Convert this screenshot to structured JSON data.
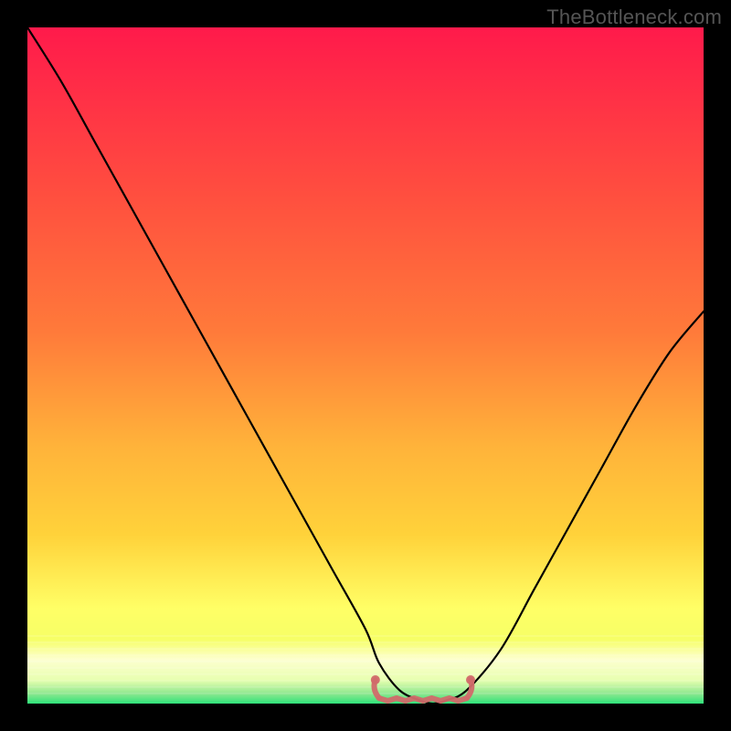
{
  "watermark": "TheBottleneck.com",
  "colors": {
    "background": "#000000",
    "gradient_top": "#ff1a4b",
    "gradient_upper_mid": "#ff7a3a",
    "gradient_mid": "#ffd23a",
    "gradient_lower_mid": "#f6ff66",
    "gradient_band_pale": "#fdffd0",
    "gradient_bottom": "#2fe27a",
    "curve_stroke": "#000000",
    "valley_marker": "#d16a6a"
  },
  "chart_data": {
    "type": "line",
    "title": "",
    "xlabel": "",
    "ylabel": "",
    "xlim": [
      0,
      100
    ],
    "ylim": [
      0,
      100
    ],
    "x": [
      0,
      5,
      10,
      15,
      20,
      25,
      30,
      35,
      40,
      45,
      50,
      52,
      55,
      58,
      60,
      62,
      65,
      70,
      75,
      80,
      85,
      90,
      95,
      100
    ],
    "values": [
      100,
      92,
      83,
      74,
      65,
      56,
      47,
      38,
      29,
      20,
      11,
      6,
      2,
      0.5,
      0,
      0.5,
      2,
      8,
      17,
      26,
      35,
      44,
      52,
      58
    ],
    "valley_region_x": [
      52,
      65
    ],
    "valley_region_y": 0,
    "grid": false,
    "legend": false
  }
}
